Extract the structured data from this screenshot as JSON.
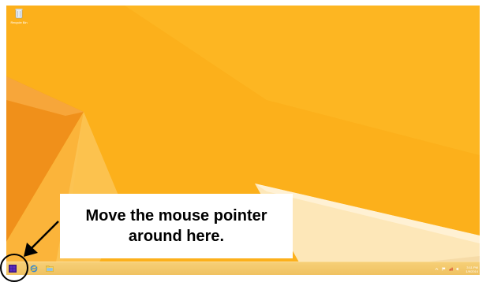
{
  "desktop": {
    "recycle_bin": {
      "label": "Recycle Bin",
      "icon": "recycle-bin-icon"
    }
  },
  "taskbar": {
    "start_icon": "windows-logo-icon",
    "pinned": [
      {
        "name": "Internet Explorer",
        "icon": "internet-explorer-icon"
      },
      {
        "name": "File Explorer",
        "icon": "folder-icon"
      }
    ],
    "tray_icons": [
      "chevron-up-icon",
      "flag-icon",
      "network-icon",
      "speaker-icon"
    ],
    "clock": {
      "time": "3:11 PM",
      "date": "1/9/2014"
    }
  },
  "callout": {
    "line1": "Move the mouse pointer",
    "line2": "around here."
  },
  "colors": {
    "wallpaper_base": "#fcb01b",
    "wallpaper_light": "#fdd06a",
    "wallpaper_dark": "#f08a16",
    "taskbar": "#f3c96d",
    "start_button": "#4b1fa5",
    "annotation": "#000000"
  }
}
